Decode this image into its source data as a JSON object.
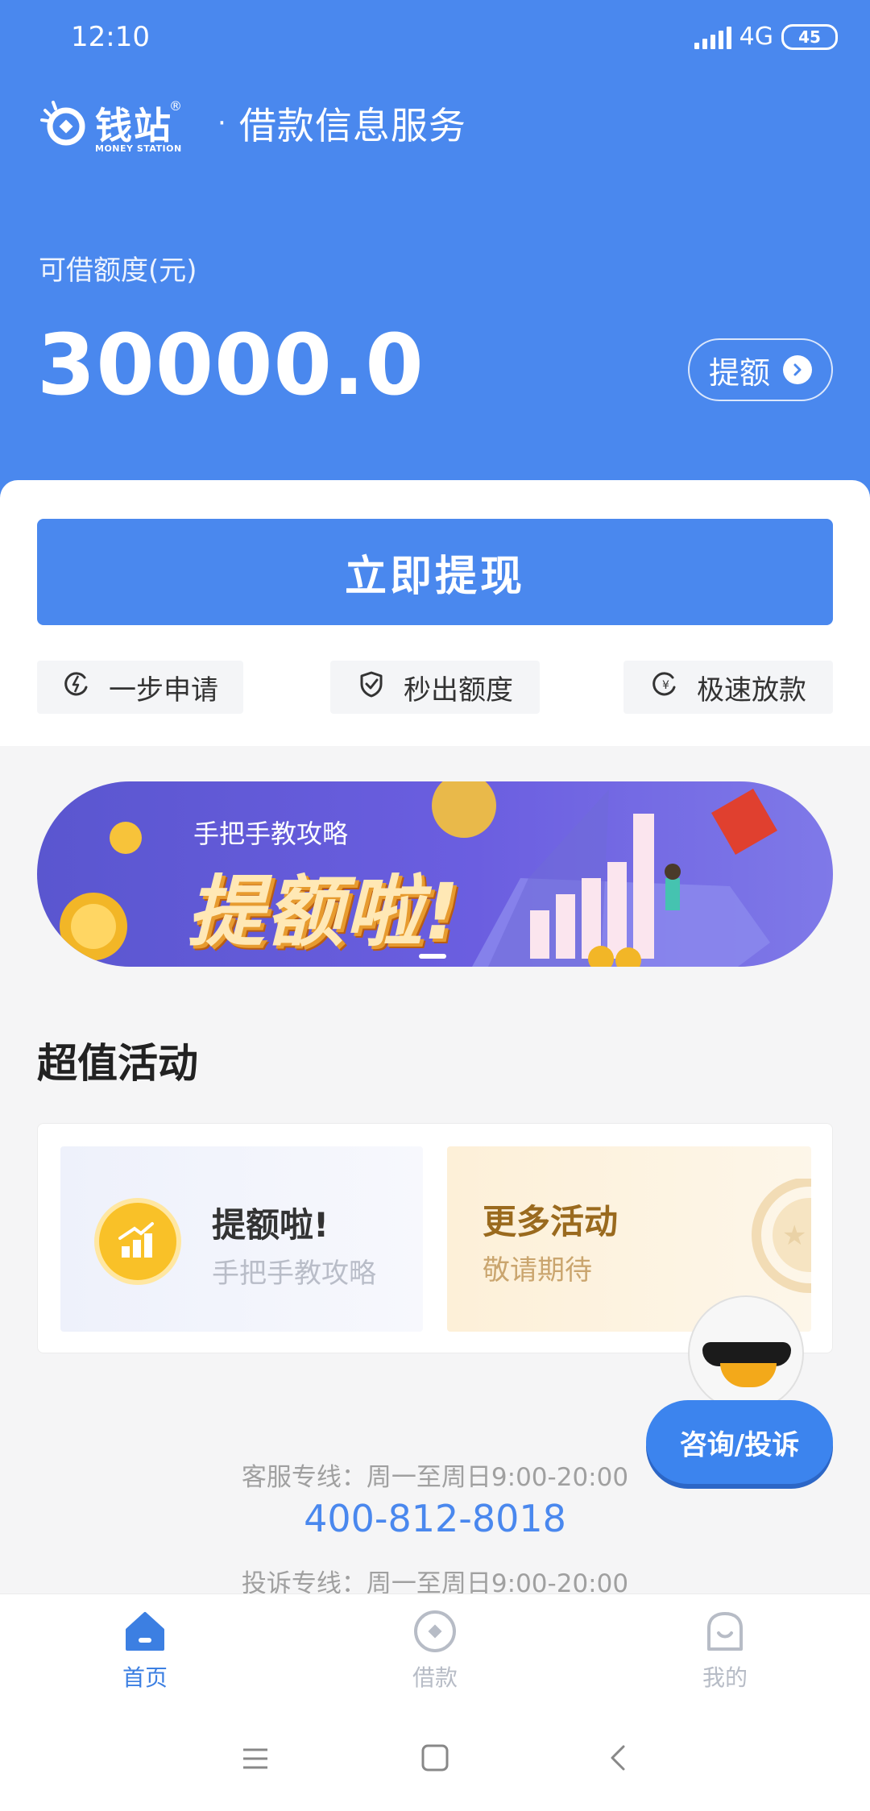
{
  "status_bar": {
    "time": "12:10",
    "network": "4G",
    "battery": "45"
  },
  "brand": {
    "name": "钱站",
    "subtitle": "MONEY STATION",
    "registered": "®",
    "separator": "·",
    "service": "借款信息服务"
  },
  "credit": {
    "label": "可借额度(元)",
    "amount": "30000.0",
    "raise_label": "提额"
  },
  "actions": {
    "withdraw_label": "立即提现",
    "features": [
      "一步申请",
      "秒出额度",
      "极速放款"
    ]
  },
  "banner": {
    "subtitle": "手把手教攻略",
    "title": "提额啦!"
  },
  "activities": {
    "section_title": "超值活动",
    "items": [
      {
        "title": "提额啦!",
        "subtitle": "手把手教攻略"
      },
      {
        "title": "更多活动",
        "subtitle": "敬请期待"
      }
    ]
  },
  "service_info": {
    "line1": "客服专线：周一至周日9:00-20:00",
    "phone": "400-812-8018",
    "line2": "投诉专线：周一至周日9:00-20:00"
  },
  "helper": {
    "label": "咨询/投诉"
  },
  "tabs": [
    {
      "label": "首页",
      "icon": "home-icon",
      "active": true
    },
    {
      "label": "借款",
      "icon": "loan-icon",
      "active": false
    },
    {
      "label": "我的",
      "icon": "profile-icon",
      "active": false
    }
  ],
  "colors": {
    "primary": "#4a88ee",
    "active_tab": "#3c7fe2",
    "inactive_tab": "#b7bcc6"
  }
}
